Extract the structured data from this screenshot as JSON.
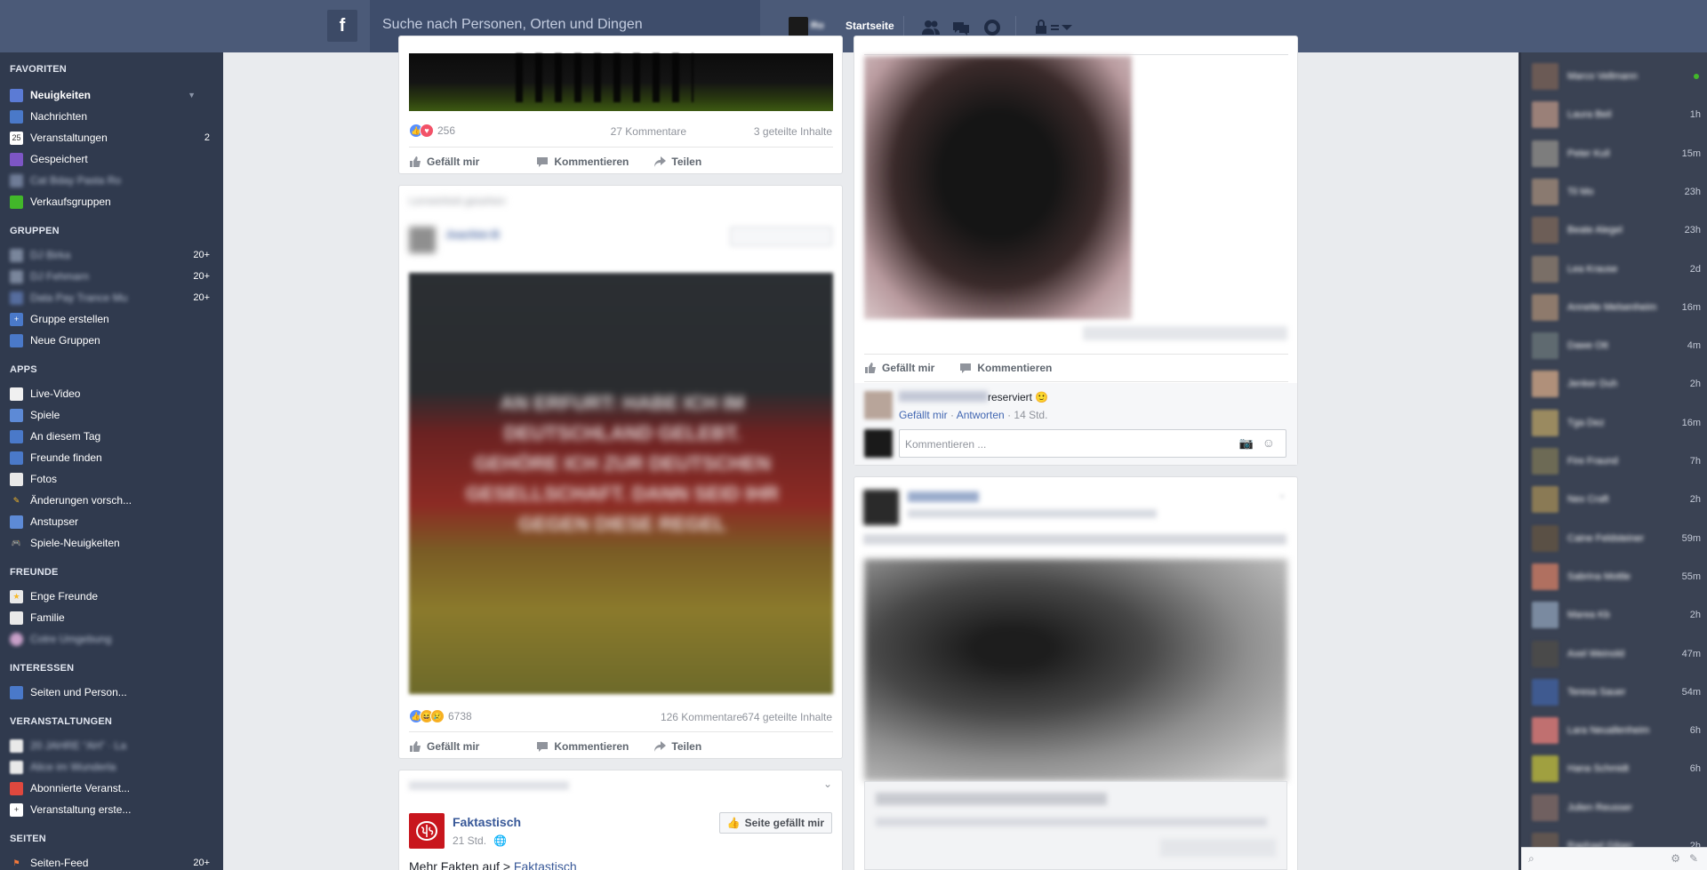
{
  "topbar": {
    "logo": "f",
    "search_placeholder": "Suche nach Personen, Orten und Dingen",
    "user_name": "Ro",
    "home_label": "Startseite"
  },
  "leftnav": {
    "favorites_title": "FAVORITEN",
    "favorites": [
      {
        "label": "Neuigkeiten",
        "count": ""
      },
      {
        "label": "Nachrichten",
        "count": ""
      },
      {
        "label": "Veranstaltungen",
        "count": "2",
        "icon_text": "25"
      },
      {
        "label": "Gespeichert",
        "count": ""
      },
      {
        "label": "Cat Bday Pasta Ro",
        "count": ""
      },
      {
        "label": "Verkaufsgruppen",
        "count": ""
      }
    ],
    "groups_title": "GRUPPEN",
    "groups": [
      {
        "label": "DJ Birka",
        "count": "20+"
      },
      {
        "label": "DJ Fehmarn",
        "count": "20+"
      },
      {
        "label": "Data Pay Trance Mu",
        "count": "20+"
      },
      {
        "label": "Gruppe erstellen",
        "count": ""
      },
      {
        "label": "Neue Gruppen",
        "count": ""
      }
    ],
    "apps_title": "APPS",
    "apps": [
      {
        "label": "Live-Video"
      },
      {
        "label": "Spiele"
      },
      {
        "label": "An diesem Tag"
      },
      {
        "label": "Freunde finden"
      },
      {
        "label": "Fotos"
      },
      {
        "label": "Änderungen vorsch..."
      },
      {
        "label": "Anstupser"
      },
      {
        "label": "Spiele-Neuigkeiten"
      }
    ],
    "friends_title": "FREUNDE",
    "friends": [
      {
        "label": "Enge Freunde"
      },
      {
        "label": "Familie"
      },
      {
        "label": "Cotre Umgebung"
      }
    ],
    "interests_title": "INTERESSEN",
    "interests": [
      {
        "label": "Seiten und Person..."
      }
    ],
    "events_title": "VERANSTALTUNGEN",
    "events": [
      {
        "label": "20 JAHRE “AH” · La"
      },
      {
        "label": "Alice im Wunderla"
      },
      {
        "label": "Abonnierte Veranst..."
      },
      {
        "label": "Veranstaltung erste..."
      }
    ],
    "pages_title": "SEITEN",
    "pages": [
      {
        "label": "Seiten-Feed",
        "count": "20+"
      }
    ]
  },
  "feed": {
    "post1": {
      "reaction_count": "256",
      "comments": "27 Kommentare",
      "shares": "3 geteilte Inhalte"
    },
    "post2": {
      "author_blur": "Joachim B",
      "header_blur": "Lerneinheit gesehen",
      "reaction_count": "6738",
      "comments": "126 Kommentare",
      "shares": "674 geteilte Inhalte",
      "image_text": "AN ERFURT: HABE ICH IM DEUTSCHLAND GELEBT. GEHÖRE ICH ZUR DEUTSCHEN GESELLSCHAFT. DANN SEID IHR GEGEN DIESE REGEL"
    },
    "post3": {
      "page_name": "Faktastisch",
      "time": "21 Std.",
      "like_page": "Seite gefällt mir",
      "text_prefix": "Mehr Fakten auf > ",
      "text_link": "Faktastisch"
    },
    "actions": {
      "like": "Gefällt mir",
      "comment": "Kommentieren",
      "share": "Teilen"
    },
    "post_right1": {
      "comment_text": "reserviert 🙂",
      "comment_like": "Gefällt mir",
      "comment_reply": "Antworten",
      "comment_time": "14 Std.",
      "comment_placeholder": "Kommentieren ..."
    }
  },
  "chat": {
    "contacts": [
      {
        "name": "Marco Vellmann",
        "time": "",
        "online": true
      },
      {
        "name": "Laura Beil",
        "time": "1h"
      },
      {
        "name": "Peter Kull",
        "time": "15m"
      },
      {
        "name": "Til Mo",
        "time": "23h"
      },
      {
        "name": "Beate Alegel",
        "time": "23h"
      },
      {
        "name": "Lea Krause",
        "time": "2d"
      },
      {
        "name": "Annette Melsenheim",
        "time": "16m"
      },
      {
        "name": "Dawe Ott",
        "time": "4m"
      },
      {
        "name": "Jenker Duh",
        "time": "2h"
      },
      {
        "name": "Tga Dez",
        "time": "16m"
      },
      {
        "name": "Fire Fraund",
        "time": "7h"
      },
      {
        "name": "Nex Craft",
        "time": "2h"
      },
      {
        "name": "Caine Feldsteiner",
        "time": "59m"
      },
      {
        "name": "Sabrina Mottle",
        "time": "55m"
      },
      {
        "name": "Marea Kb",
        "time": "2h"
      },
      {
        "name": "Axel Weinold",
        "time": "47m"
      },
      {
        "name": "Teresa Sauer",
        "time": "54m"
      },
      {
        "name": "Lara Neuallenheim",
        "time": "6h"
      },
      {
        "name": "Hana Schmidt",
        "time": "6h"
      },
      {
        "name": "Julien Reusser",
        "time": ""
      },
      {
        "name": "Raphael Gilger",
        "time": "2h"
      }
    ]
  }
}
